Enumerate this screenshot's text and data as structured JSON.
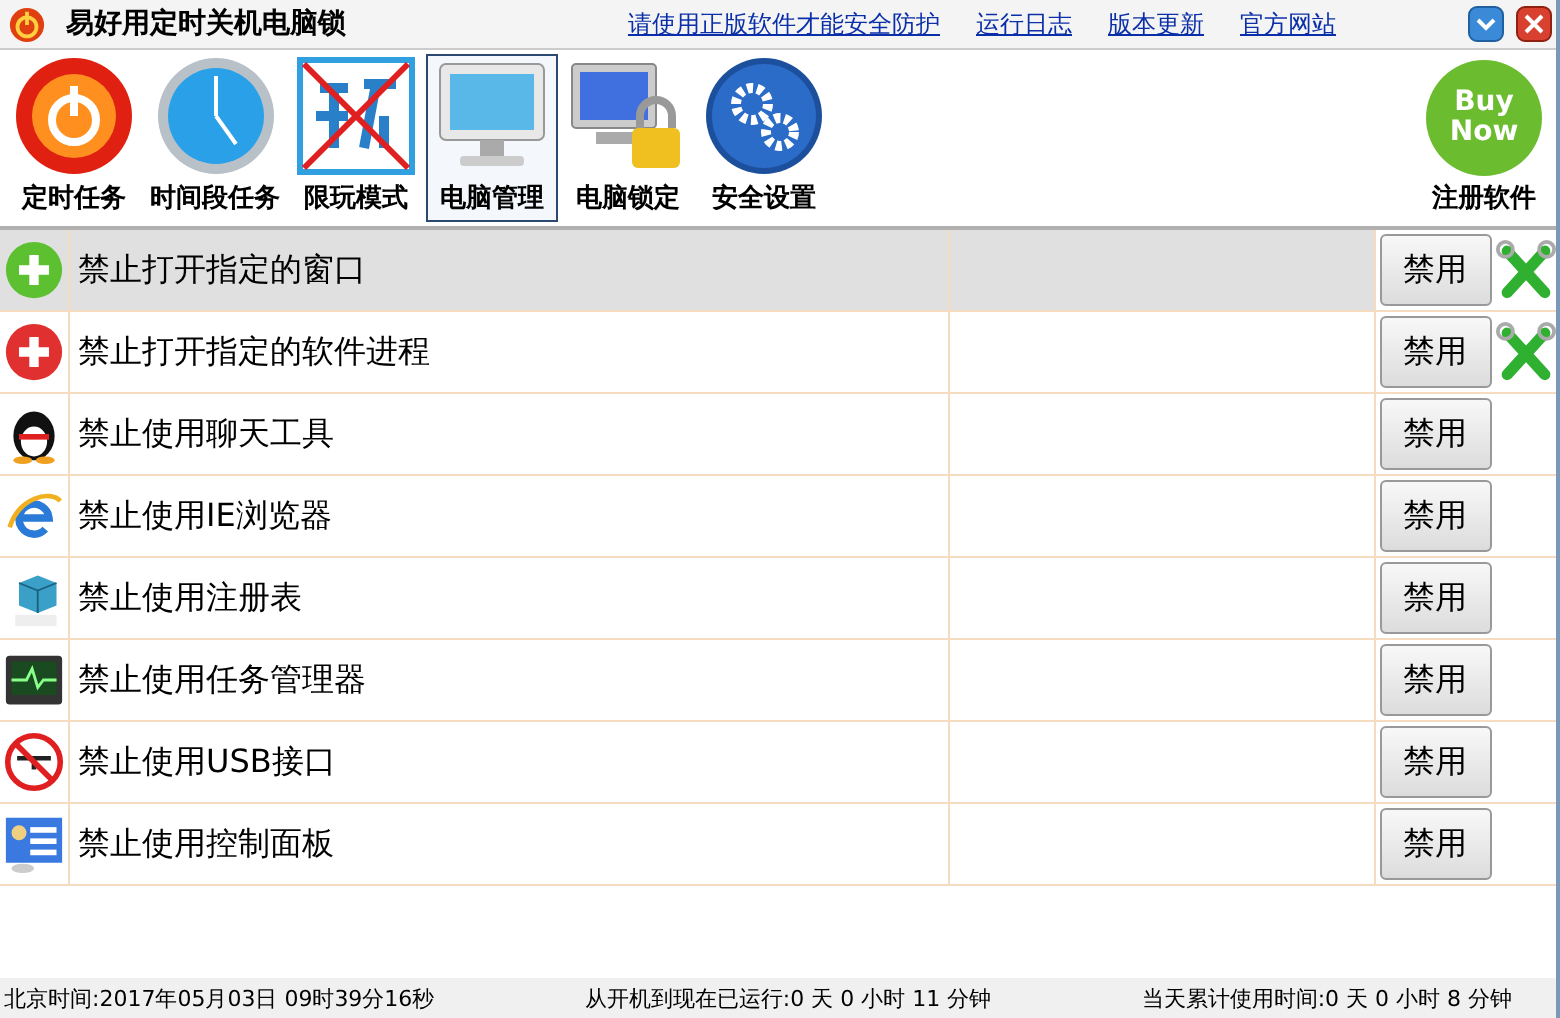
{
  "window": {
    "title": "易好用定时关机电脑锁"
  },
  "header_links": [
    "请使用正版软件才能安全防护",
    "运行日志",
    "版本更新",
    "官方网站"
  ],
  "toolbar": [
    {
      "label": "定时任务",
      "kind": "power",
      "selected": false
    },
    {
      "label": "时间段任务",
      "kind": "clock",
      "selected": false
    },
    {
      "label": "限玩模式",
      "kind": "noplay",
      "selected": false
    },
    {
      "label": "电脑管理",
      "kind": "monitor",
      "selected": true
    },
    {
      "label": "电脑锁定",
      "kind": "lock",
      "selected": false
    },
    {
      "label": "安全设置",
      "kind": "gears",
      "selected": false
    }
  ],
  "register": {
    "label": "注册软件",
    "badge_line_1": "Buy",
    "badge_line_2": "Now"
  },
  "rows": [
    {
      "kind": "plus",
      "name": "禁止打开指定的窗口",
      "button": "禁用",
      "configurable": true,
      "selected": true
    },
    {
      "kind": "redplus",
      "name": "禁止打开指定的软件进程",
      "button": "禁用",
      "configurable": true,
      "selected": false
    },
    {
      "kind": "penguin",
      "name": "禁止使用聊天工具",
      "button": "禁用",
      "configurable": false,
      "selected": false
    },
    {
      "kind": "ie",
      "name": "禁止使用IE浏览器",
      "button": "禁用",
      "configurable": false,
      "selected": false
    },
    {
      "kind": "reg",
      "name": "禁止使用注册表",
      "button": "禁用",
      "configurable": false,
      "selected": false
    },
    {
      "kind": "taskmgr",
      "name": "禁止使用任务管理器",
      "button": "禁用",
      "configurable": false,
      "selected": false
    },
    {
      "kind": "usb",
      "name": "禁止使用USB接口",
      "button": "禁用",
      "configurable": false,
      "selected": false
    },
    {
      "kind": "panel",
      "name": "禁止使用控制面板",
      "button": "禁用",
      "configurable": false,
      "selected": false
    }
  ],
  "status_bar": [
    "北京时间:2017年05月03日 09时39分16秒",
    "从开机到现在已运行:0 天 0 小时 11 分钟",
    "当天累计使用时间:0 天 0 小时 8 分钟"
  ]
}
